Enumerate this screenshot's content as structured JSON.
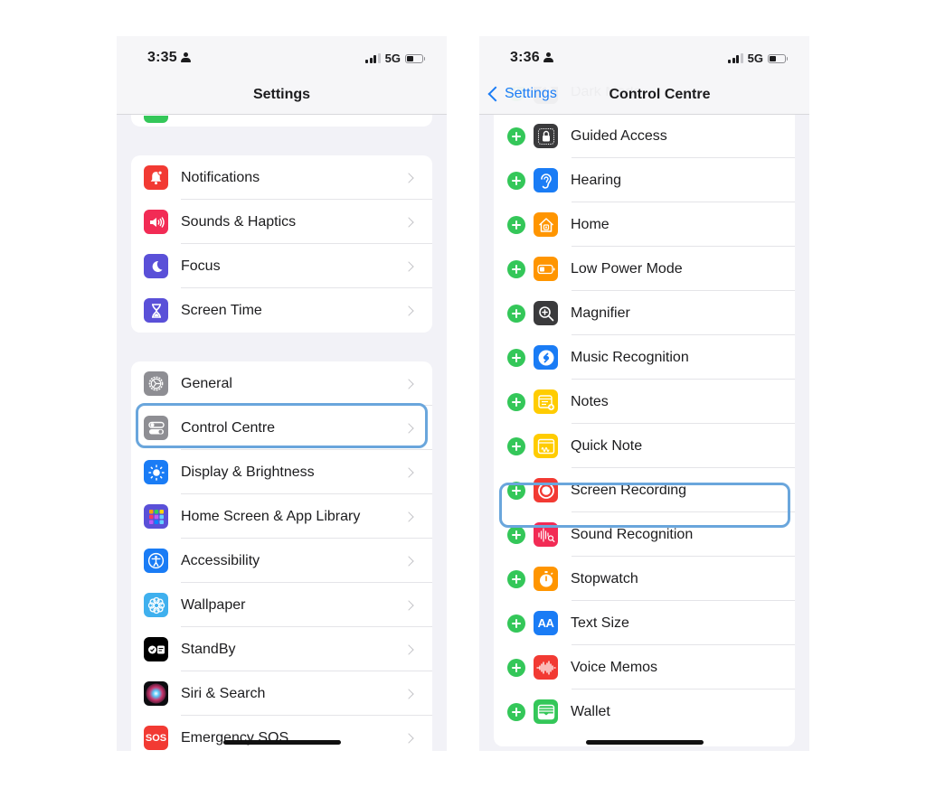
{
  "left_screen": {
    "status": {
      "time": "3:35",
      "network": "5G",
      "battery_level": 0.45
    },
    "nav": {
      "title": "Settings"
    },
    "groups": [
      {
        "items": [
          {
            "label": "Notifications",
            "icon": "bell-icon",
            "color": "#f23a33"
          },
          {
            "label": "Sounds & Haptics",
            "icon": "speaker-icon",
            "color": "#f22b55"
          },
          {
            "label": "Focus",
            "icon": "moon-icon",
            "color": "#5a50d8"
          },
          {
            "label": "Screen Time",
            "icon": "hourglass-icon",
            "color": "#5a50d8"
          }
        ]
      },
      {
        "items": [
          {
            "label": "General",
            "icon": "gear-icon",
            "color": "#8e8e93"
          },
          {
            "label": "Control Centre",
            "icon": "toggles-icon",
            "color": "#8e8e93",
            "highlighted": true
          },
          {
            "label": "Display & Brightness",
            "icon": "sun-icon",
            "color": "#1a7cf5"
          },
          {
            "label": "Home Screen & App Library",
            "icon": "app-grid-icon",
            "color": "#5a50d8"
          },
          {
            "label": "Accessibility",
            "icon": "accessibility-icon",
            "color": "#1a7cf5"
          },
          {
            "label": "Wallpaper",
            "icon": "flower-icon",
            "color": "#3fb0ee"
          },
          {
            "label": "StandBy",
            "icon": "standby-icon",
            "color": "#000000"
          },
          {
            "label": "Siri & Search",
            "icon": "siri-icon",
            "color": "#2a1a2e"
          },
          {
            "label": "Emergency SOS",
            "icon": "sos-icon",
            "color": "#f23a33",
            "icon_text": "SOS"
          }
        ]
      }
    ]
  },
  "right_screen": {
    "status": {
      "time": "3:36",
      "network": "5G",
      "battery_level": 0.45
    },
    "nav": {
      "back_label": "Settings",
      "title": "Control Centre"
    },
    "items": [
      {
        "label": "Dark Mode",
        "icon": "dark-mode-icon",
        "color": "#3a3a3c",
        "partially_hidden": true
      },
      {
        "label": "Guided Access",
        "icon": "lock-icon",
        "color": "#3a3a3c"
      },
      {
        "label": "Hearing",
        "icon": "ear-icon",
        "color": "#1a7cf5"
      },
      {
        "label": "Home",
        "icon": "house-icon",
        "color": "#ff9500"
      },
      {
        "label": "Low Power Mode",
        "icon": "battery-icon",
        "color": "#ff9500"
      },
      {
        "label": "Magnifier",
        "icon": "magnifier-icon",
        "color": "#3a3a3c"
      },
      {
        "label": "Music Recognition",
        "icon": "shazam-icon",
        "color": "#1a7cf5"
      },
      {
        "label": "Notes",
        "icon": "notes-icon",
        "color": "#ffcc00"
      },
      {
        "label": "Quick Note",
        "icon": "quick-note-icon",
        "color": "#ffcc00"
      },
      {
        "label": "Screen Recording",
        "icon": "record-icon",
        "color": "#f23a33",
        "highlighted": true
      },
      {
        "label": "Sound Recognition",
        "icon": "sound-recognition-icon",
        "color": "#f22b55"
      },
      {
        "label": "Stopwatch",
        "icon": "stopwatch-icon",
        "color": "#ff9500"
      },
      {
        "label": "Text Size",
        "icon": "text-size-icon",
        "color": "#1a7cf5",
        "icon_text": "AA"
      },
      {
        "label": "Voice Memos",
        "icon": "waveform-icon",
        "color": "#f23a33"
      },
      {
        "label": "Wallet",
        "icon": "wallet-icon",
        "color": "#34c759"
      }
    ]
  },
  "highlight_color": "#6aa6dc",
  "add_button_color": "#34c759"
}
